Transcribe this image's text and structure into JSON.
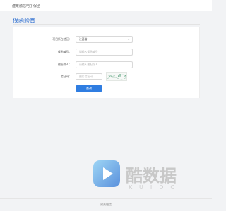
{
  "app": {
    "brand": "建莱融信电子保函"
  },
  "page": {
    "title": "保函验真"
  },
  "form": {
    "region": {
      "label": "项目所在地区：",
      "value": "江西省"
    },
    "guarantee_no": {
      "label": "保函编号：",
      "placeholder": "请输入保函编号"
    },
    "applicant": {
      "label": "被担保人：",
      "placeholder": "请输入被担保人"
    },
    "captcha": {
      "label": "验证码：",
      "placeholder": "图片验证码",
      "image_text": "ux 6 e"
    },
    "submit_label": "查询"
  },
  "watermark": {
    "brand": "酷数据",
    "sub": "KUIDC"
  },
  "footer": {
    "text": "建莱融信"
  },
  "colors": {
    "accent": "#2f7de1",
    "title": "#2f6fd0"
  }
}
